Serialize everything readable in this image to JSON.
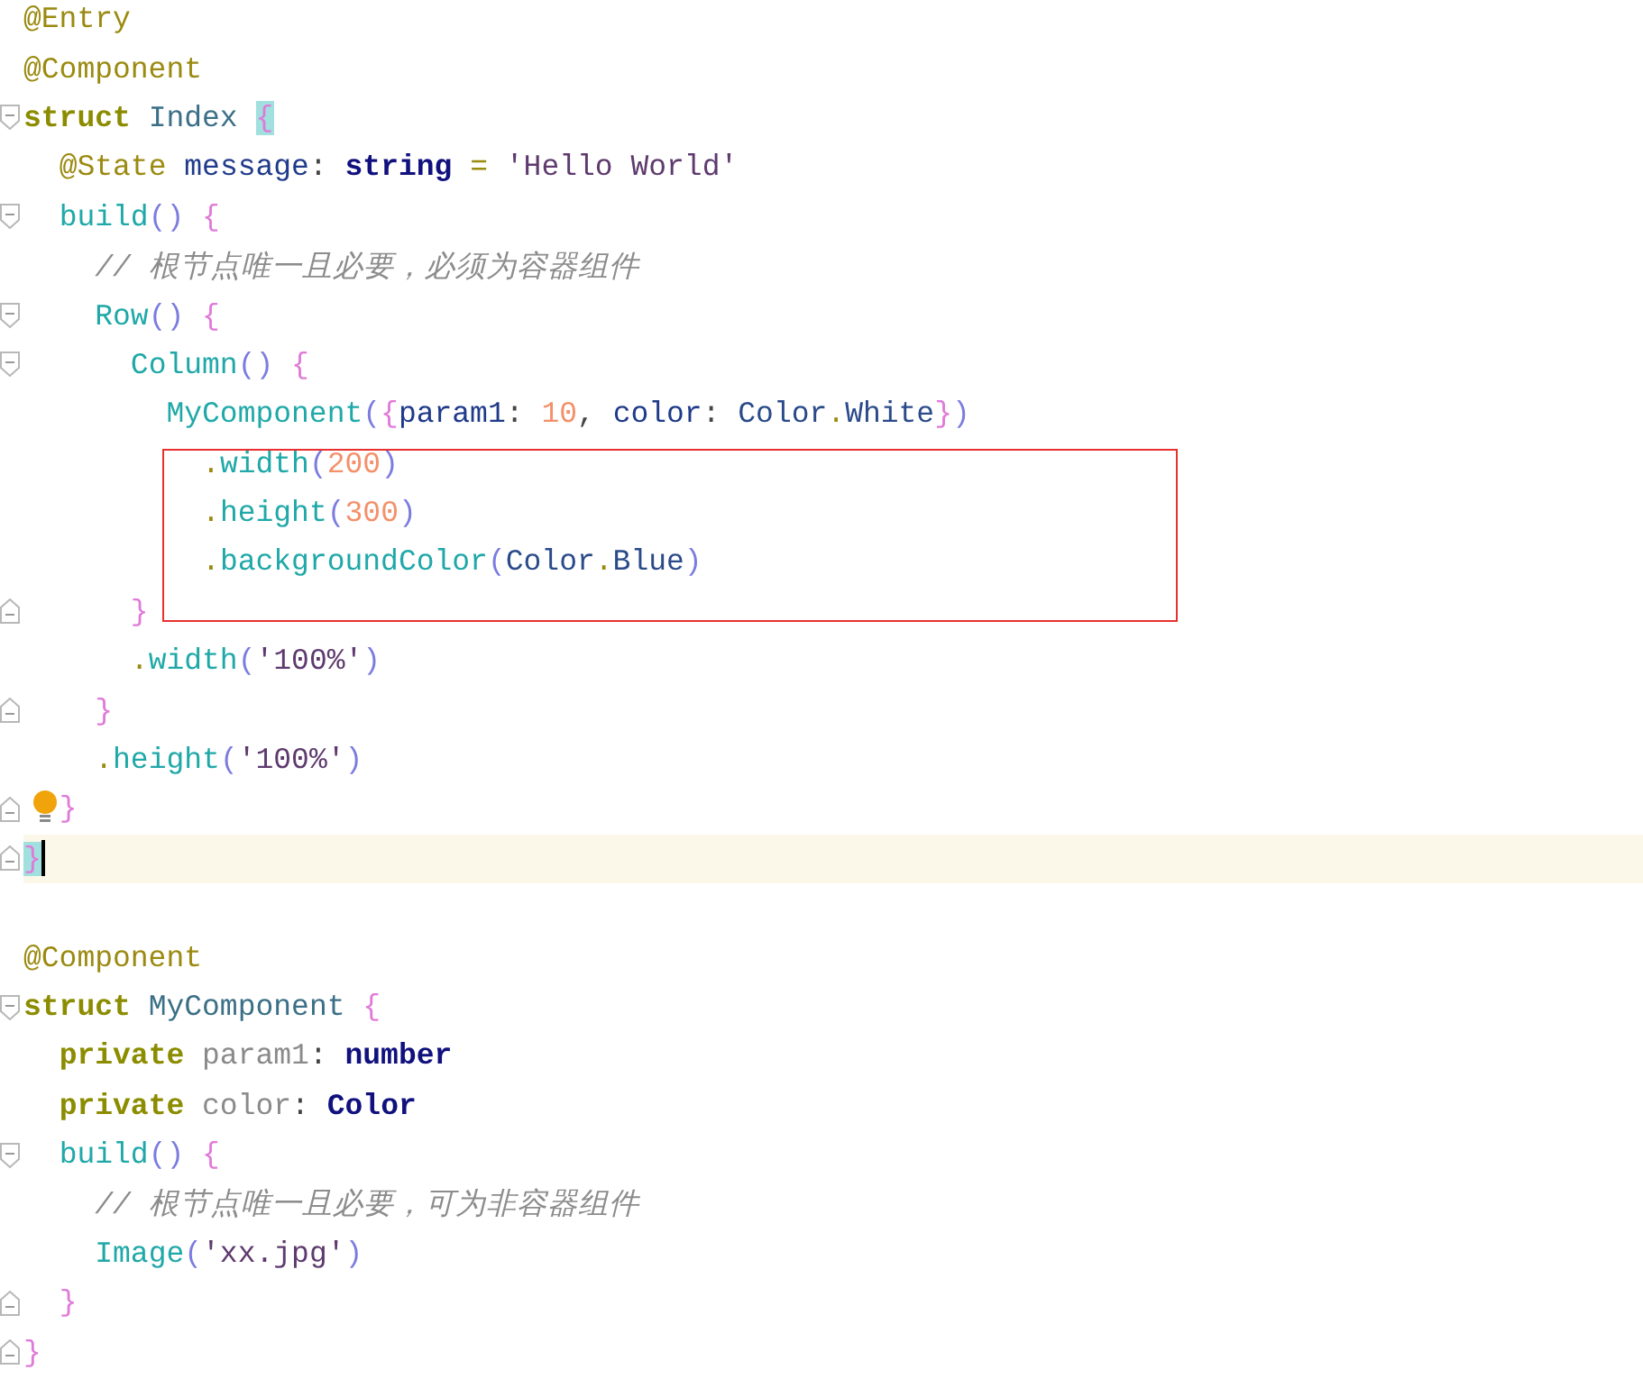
{
  "editor": {
    "lines": [
      {
        "kind": "code",
        "fold_start": false,
        "fold_end": false,
        "tokens": [
          {
            "t": "@Entry",
            "kind": "decorator"
          }
        ]
      },
      {
        "kind": "code",
        "fold_start": false,
        "fold_end": false,
        "tokens": [
          {
            "t": "@Component",
            "kind": "decorator"
          }
        ]
      },
      {
        "kind": "code",
        "fold_start": true,
        "fold_end": false,
        "tokens": [
          {
            "t": "struct",
            "kind": "keyword"
          },
          {
            "t": " Index ",
            "kind": "type"
          },
          {
            "t": "{",
            "kind": "brace-match"
          }
        ]
      },
      {
        "kind": "code",
        "fold_start": false,
        "fold_end": false,
        "tokens": [
          {
            "t": "  @State",
            "kind": "decorator"
          },
          {
            "t": " message",
            "kind": "field"
          },
          {
            "t": ": ",
            "kind": "plain"
          },
          {
            "t": "string",
            "kind": "builtin"
          },
          {
            "t": " = ",
            "kind": "op"
          },
          {
            "t": "'Hello World'",
            "kind": "string"
          }
        ]
      },
      {
        "kind": "code",
        "fold_start": true,
        "fold_end": false,
        "tokens": [
          {
            "t": "  build",
            "kind": "func"
          },
          {
            "t": "()",
            "kind": "paren"
          },
          {
            "t": " {",
            "kind": "brace"
          }
        ]
      },
      {
        "kind": "code",
        "fold_start": false,
        "fold_end": false,
        "tokens": [
          {
            "t": "    // 根节点唯一且必要，必须为容器组件",
            "kind": "comment"
          }
        ]
      },
      {
        "kind": "code",
        "fold_start": true,
        "fold_end": false,
        "tokens": [
          {
            "t": "    Row",
            "kind": "func"
          },
          {
            "t": "()",
            "kind": "paren"
          },
          {
            "t": " {",
            "kind": "brace"
          }
        ]
      },
      {
        "kind": "code",
        "fold_start": true,
        "fold_end": false,
        "tokens": [
          {
            "t": "      Column",
            "kind": "func"
          },
          {
            "t": "()",
            "kind": "paren"
          },
          {
            "t": " {",
            "kind": "brace"
          }
        ]
      },
      {
        "kind": "code",
        "fold_start": false,
        "fold_end": false,
        "tokens": [
          {
            "t": "        MyComponent",
            "kind": "func"
          },
          {
            "t": "(",
            "kind": "paren"
          },
          {
            "t": "{",
            "kind": "brace"
          },
          {
            "t": "param1",
            "kind": "field"
          },
          {
            "t": ": ",
            "kind": "plain"
          },
          {
            "t": "10",
            "kind": "number"
          },
          {
            "t": ", ",
            "kind": "plain"
          },
          {
            "t": "color",
            "kind": "field"
          },
          {
            "t": ": ",
            "kind": "plain"
          },
          {
            "t": "Color",
            "kind": "type2"
          },
          {
            "t": ".",
            "kind": "op"
          },
          {
            "t": "White",
            "kind": "type2"
          },
          {
            "t": "}",
            "kind": "brace"
          },
          {
            "t": ")",
            "kind": "paren"
          }
        ]
      },
      {
        "kind": "code",
        "fold_start": false,
        "fold_end": false,
        "boxed": true,
        "tokens": [
          {
            "t": "          .",
            "kind": "op"
          },
          {
            "t": "width",
            "kind": "func"
          },
          {
            "t": "(",
            "kind": "paren"
          },
          {
            "t": "200",
            "kind": "number"
          },
          {
            "t": ")",
            "kind": "paren"
          }
        ]
      },
      {
        "kind": "code",
        "fold_start": false,
        "fold_end": false,
        "boxed": true,
        "tokens": [
          {
            "t": "          .",
            "kind": "op"
          },
          {
            "t": "height",
            "kind": "func"
          },
          {
            "t": "(",
            "kind": "paren"
          },
          {
            "t": "300",
            "kind": "number"
          },
          {
            "t": ")",
            "kind": "paren"
          }
        ]
      },
      {
        "kind": "code",
        "fold_start": false,
        "fold_end": false,
        "boxed": true,
        "tokens": [
          {
            "t": "          .",
            "kind": "op"
          },
          {
            "t": "backgroundColor",
            "kind": "func"
          },
          {
            "t": "(",
            "kind": "paren"
          },
          {
            "t": "Color",
            "kind": "type2"
          },
          {
            "t": ".",
            "kind": "op"
          },
          {
            "t": "Blue",
            "kind": "type2"
          },
          {
            "t": ")",
            "kind": "paren"
          }
        ]
      },
      {
        "kind": "code",
        "fold_start": false,
        "fold_end": true,
        "boxed": true,
        "tokens": [
          {
            "t": "      }",
            "kind": "brace"
          }
        ]
      },
      {
        "kind": "code",
        "fold_start": false,
        "fold_end": false,
        "tokens": [
          {
            "t": "      .",
            "kind": "op"
          },
          {
            "t": "width",
            "kind": "func"
          },
          {
            "t": "(",
            "kind": "paren"
          },
          {
            "t": "'100%'",
            "kind": "string"
          },
          {
            "t": ")",
            "kind": "paren"
          }
        ]
      },
      {
        "kind": "code",
        "fold_start": false,
        "fold_end": true,
        "tokens": [
          {
            "t": "    }",
            "kind": "brace"
          }
        ]
      },
      {
        "kind": "code",
        "fold_start": false,
        "fold_end": false,
        "tokens": [
          {
            "t": "    .",
            "kind": "op"
          },
          {
            "t": "height",
            "kind": "func"
          },
          {
            "t": "(",
            "kind": "paren"
          },
          {
            "t": "'100%'",
            "kind": "string"
          },
          {
            "t": ")",
            "kind": "paren"
          }
        ]
      },
      {
        "kind": "code",
        "fold_start": false,
        "fold_end": true,
        "hint": true,
        "tokens": [
          {
            "t": "  }",
            "kind": "brace"
          }
        ]
      },
      {
        "kind": "code",
        "fold_start": false,
        "fold_end": true,
        "current": true,
        "tokens": [
          {
            "t": "}",
            "kind": "brace-match"
          }
        ]
      },
      {
        "kind": "blank"
      },
      {
        "kind": "code",
        "fold_start": false,
        "fold_end": false,
        "tokens": [
          {
            "t": "@Component",
            "kind": "decorator"
          }
        ]
      },
      {
        "kind": "code",
        "fold_start": true,
        "fold_end": false,
        "tokens": [
          {
            "t": "struct",
            "kind": "keyword"
          },
          {
            "t": " MyComponent ",
            "kind": "type"
          },
          {
            "t": "{",
            "kind": "brace"
          }
        ]
      },
      {
        "kind": "code",
        "fold_start": false,
        "fold_end": false,
        "tokens": [
          {
            "t": "  private",
            "kind": "keyword"
          },
          {
            "t": " param1",
            "kind": "member"
          },
          {
            "t": ": ",
            "kind": "plain"
          },
          {
            "t": "number",
            "kind": "builtin"
          }
        ]
      },
      {
        "kind": "code",
        "fold_start": false,
        "fold_end": false,
        "tokens": [
          {
            "t": "  private",
            "kind": "keyword"
          },
          {
            "t": " color",
            "kind": "member"
          },
          {
            "t": ": ",
            "kind": "plain"
          },
          {
            "t": "Color",
            "kind": "builtin"
          }
        ]
      },
      {
        "kind": "code",
        "fold_start": true,
        "fold_end": false,
        "tokens": [
          {
            "t": "  build",
            "kind": "func"
          },
          {
            "t": "()",
            "kind": "paren"
          },
          {
            "t": " {",
            "kind": "brace"
          }
        ]
      },
      {
        "kind": "code",
        "fold_start": false,
        "fold_end": false,
        "tokens": [
          {
            "t": "    // 根节点唯一且必要，可为非容器组件",
            "kind": "comment"
          }
        ]
      },
      {
        "kind": "code",
        "fold_start": false,
        "fold_end": false,
        "tokens": [
          {
            "t": "    Image",
            "kind": "func"
          },
          {
            "t": "(",
            "kind": "paren"
          },
          {
            "t": "'xx.jpg'",
            "kind": "string"
          },
          {
            "t": ")",
            "kind": "paren"
          }
        ]
      },
      {
        "kind": "code",
        "fold_start": false,
        "fold_end": true,
        "tokens": [
          {
            "t": "  }",
            "kind": "brace"
          }
        ]
      },
      {
        "kind": "code",
        "fold_start": false,
        "fold_end": true,
        "tokens": [
          {
            "t": "}",
            "kind": "brace"
          }
        ]
      }
    ]
  }
}
